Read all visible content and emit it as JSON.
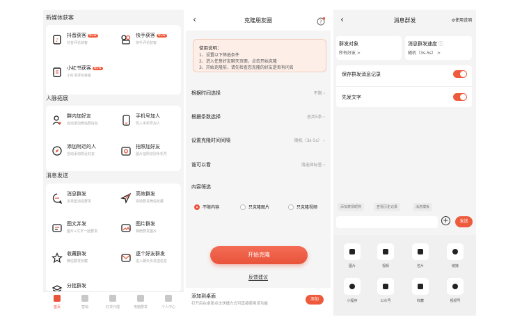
{
  "p1": {
    "sections": [
      {
        "title": "新媒体获客"
      },
      {
        "title": "人脉拓展"
      },
      {
        "title": "消息发送"
      }
    ],
    "features": [
      {
        "name": "抖音获客",
        "desc": "抖音评论获客",
        "badge": "NEW"
      },
      {
        "name": "快手获客",
        "desc": "快手评论获客",
        "badge": "NEW"
      },
      {
        "name": "小红书获客",
        "desc": "小红书评论获客",
        "badge": "NEW"
      },
      {
        "name": "群内加好友",
        "desc": "自动添加微信群好友"
      },
      {
        "name": "手机号加人",
        "desc": "导入手机号加人"
      },
      {
        "name": "添加附近的人",
        "desc": "自动添加附近好友"
      },
      {
        "name": "拍照加好友",
        "desc": "图片拍照识别手机号"
      },
      {
        "name": "消息群发",
        "desc": "多类型消息群发"
      },
      {
        "name": "高效群发",
        "desc": "高效群发微信收藏"
      },
      {
        "name": "图文并发",
        "desc": "图片+文字一起群发"
      },
      {
        "name": "图片群发",
        "desc": "相册群发图片"
      },
      {
        "name": "收藏群发",
        "desc": "微信群发收藏"
      },
      {
        "name": "逐个好友群发",
        "desc": "进入聊天页发送信息"
      },
      {
        "name": "分批群发"
      }
    ],
    "tabs": [
      "首页",
      "营销",
      "好货代理",
      "电脑群发",
      "个人中心"
    ]
  },
  "p2": {
    "title": "克隆朋友圈",
    "notice": [
      "使用说明：",
      "1、设置以下筛选条件",
      "2、进入任意好友聊天页面，点击开始克隆",
      "3、开始克隆前，请先检查您克隆的好友是否有问名"
    ],
    "rows": [
      {
        "label": "根据时间选择",
        "value": "不限"
      },
      {
        "label": "根据条数选择",
        "value": "总共5条"
      },
      {
        "label": "设置克隆时间间隔",
        "value": "随机（3s-5s）"
      },
      {
        "label": "谁可以看",
        "value": "请选择标签"
      }
    ],
    "filter_title": "内容筛选",
    "filters": [
      "不限内容",
      "只克隆图片",
      "只克隆视频"
    ],
    "start": "开始克隆",
    "feedback": "反馈建议",
    "bottom_title": "添加到桌面",
    "bottom_desc": "打开后在桌面点击快捷方式可直接使用该功能",
    "add": "添加"
  },
  "p3": {
    "title": "消息群发",
    "help": "使用说明",
    "target_label": "群发对象",
    "target_value": "所有好友 >",
    "speed_label": "消息群发速度",
    "speed_value": "随机（3s-5s） >",
    "save_record": "保存群发消息记录",
    "send_text_first": "先发文字",
    "chips": [
      "添加表情昵称",
      "查看历史记录",
      "消息模板"
    ],
    "send": "发送",
    "tools": [
      "图片",
      "视频",
      "名片",
      "链接",
      "小程序",
      "公众号",
      "收藏",
      "视频号"
    ]
  },
  "colors": {
    "accent": "#ee5a3c"
  }
}
